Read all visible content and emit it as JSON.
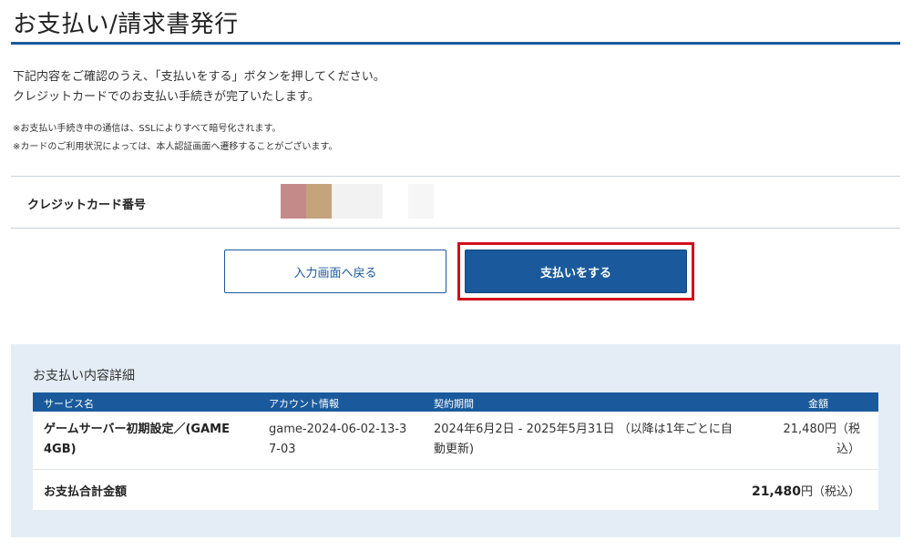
{
  "header": {
    "title": "お支払い/請求書発行"
  },
  "intro": {
    "line1": "下記内容をご確認のうえ、「支払いをする」ボタンを押してください。",
    "line2": "クレジットカードでのお支払い手続きが完了いたします。"
  },
  "notes": {
    "line1": "※お支払い手続き中の通信は、SSLによりすべて暗号化されます。",
    "line2": "※カードのご利用状況によっては、本人認証画面へ遷移することがございます。"
  },
  "card": {
    "label": "クレジットカード番号",
    "mask_colors": [
      "#c48a8a",
      "#c4a47a",
      "#f2f2f2",
      "#f6f6f6"
    ]
  },
  "buttons": {
    "back_label": "入力画面へ戻る",
    "pay_label": "支払いをする"
  },
  "details": {
    "title": "お支払い内容詳細",
    "columns": [
      "サービス名",
      "アカウント情報",
      "契約期間",
      "金額"
    ],
    "row": {
      "service_line1": "ゲームサーバー初期設定／(GAME",
      "service_line2": "4GB)",
      "account_line1": "game-2024-06-02-13-3",
      "account_line2": "7-03",
      "period_line1": "2024年6月2日 - 2025年5月31日 （以降は1年ごとに自",
      "period_line2": "動更新)",
      "amount_line1": "21,480円（税",
      "amount_line2": "込）"
    },
    "total": {
      "label": "お支払合計金額",
      "amount": "21,480",
      "suffix": "円（税込）"
    }
  },
  "colors": {
    "accent": "#1a5a9c",
    "highlight": "#d0101c",
    "panel": "#e4edf5"
  }
}
